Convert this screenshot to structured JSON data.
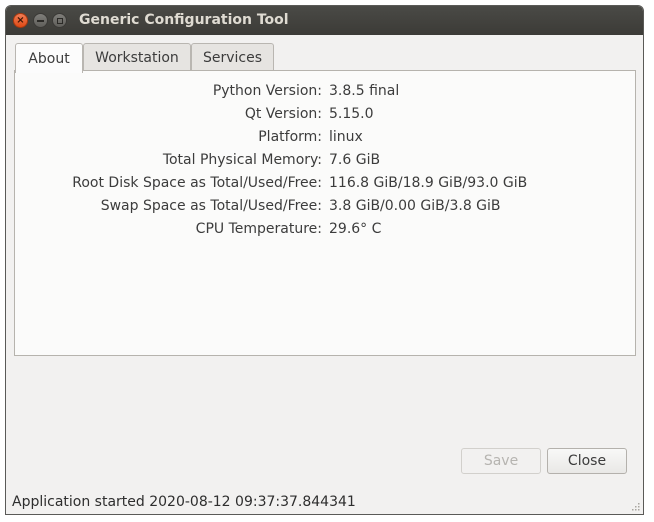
{
  "window": {
    "title": "Generic Configuration Tool",
    "close_icon": "×",
    "titlebar_color": "#3c3b37",
    "close_button_color": "#df4a16"
  },
  "tabs": [
    {
      "label": "About",
      "active": true
    },
    {
      "label": "Workstation",
      "active": false
    },
    {
      "label": "Services",
      "active": false
    }
  ],
  "about": {
    "rows": [
      {
        "label": "Python Version:",
        "value": "3.8.5 final"
      },
      {
        "label": "Qt Version:",
        "value": "5.15.0"
      },
      {
        "label": "Platform:",
        "value": "linux"
      },
      {
        "label": "Total Physical Memory:",
        "value": "7.6 GiB"
      },
      {
        "label": "Root Disk Space as Total/Used/Free:",
        "value": "116.8 GiB/18.9 GiB/93.0 GiB"
      },
      {
        "label": "Swap Space as Total/Used/Free:",
        "value": "3.8 GiB/0.00 GiB/3.8 GiB"
      },
      {
        "label": "CPU Temperature:",
        "value": "29.6° C"
      }
    ]
  },
  "buttons": {
    "save_label": "Save",
    "save_enabled": false,
    "close_label": "Close"
  },
  "statusbar": {
    "message": "Application started 2020-08-12 09:37:37.844341"
  }
}
